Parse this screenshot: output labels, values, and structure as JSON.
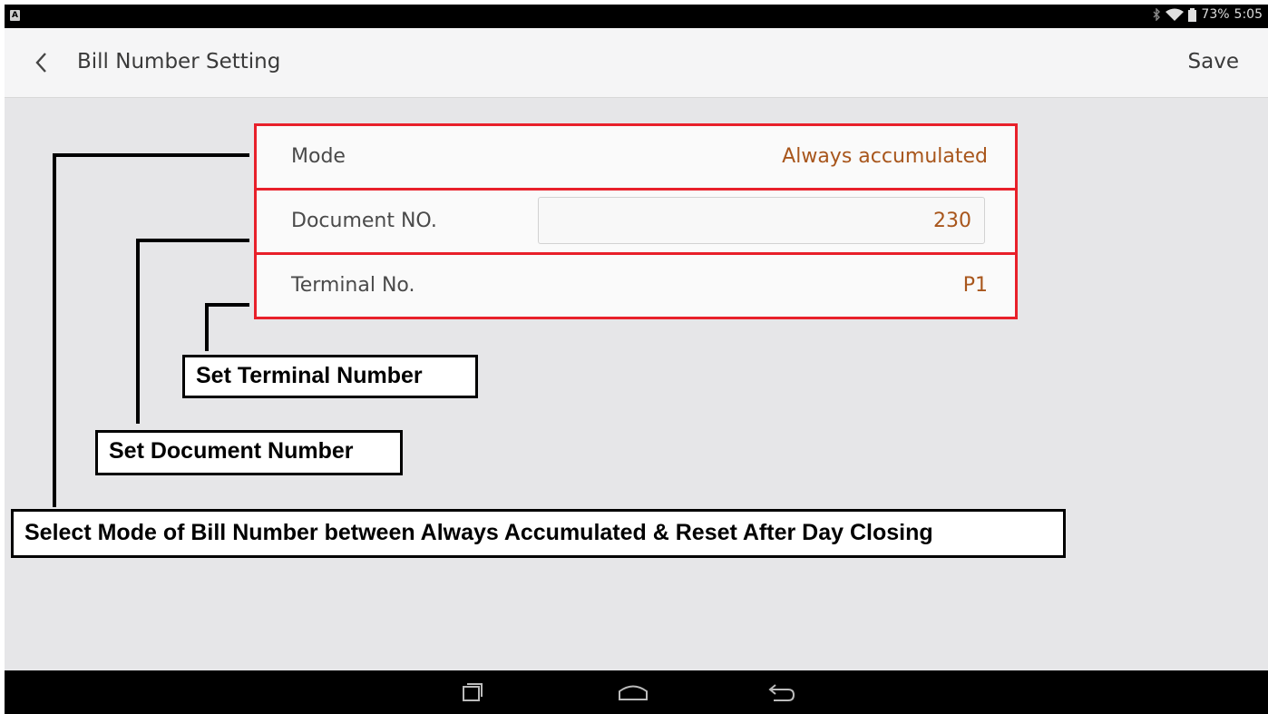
{
  "status_bar": {
    "notification_icon": "A",
    "battery": "73%",
    "time": "5:05"
  },
  "header": {
    "title": "Bill Number Setting",
    "save_label": "Save"
  },
  "settings": {
    "mode": {
      "label": "Mode",
      "value": "Always accumulated"
    },
    "document_no": {
      "label": "Document NO.",
      "value": "230"
    },
    "terminal_no": {
      "label": "Terminal No.",
      "value": "P1"
    }
  },
  "annotations": {
    "terminal": "Set Terminal Number",
    "document": "Set Document Number",
    "mode": "Select Mode of Bill Number between Always Accumulated & Reset After Day Closing"
  },
  "colors": {
    "highlight_border": "#e8202a",
    "value_text": "#a8561c",
    "background": "#e6e6e8"
  },
  "icons": {
    "back": "chevron-left-icon",
    "recent": "recent-apps-icon",
    "home": "home-icon",
    "nav_back": "back-arrow-icon"
  }
}
